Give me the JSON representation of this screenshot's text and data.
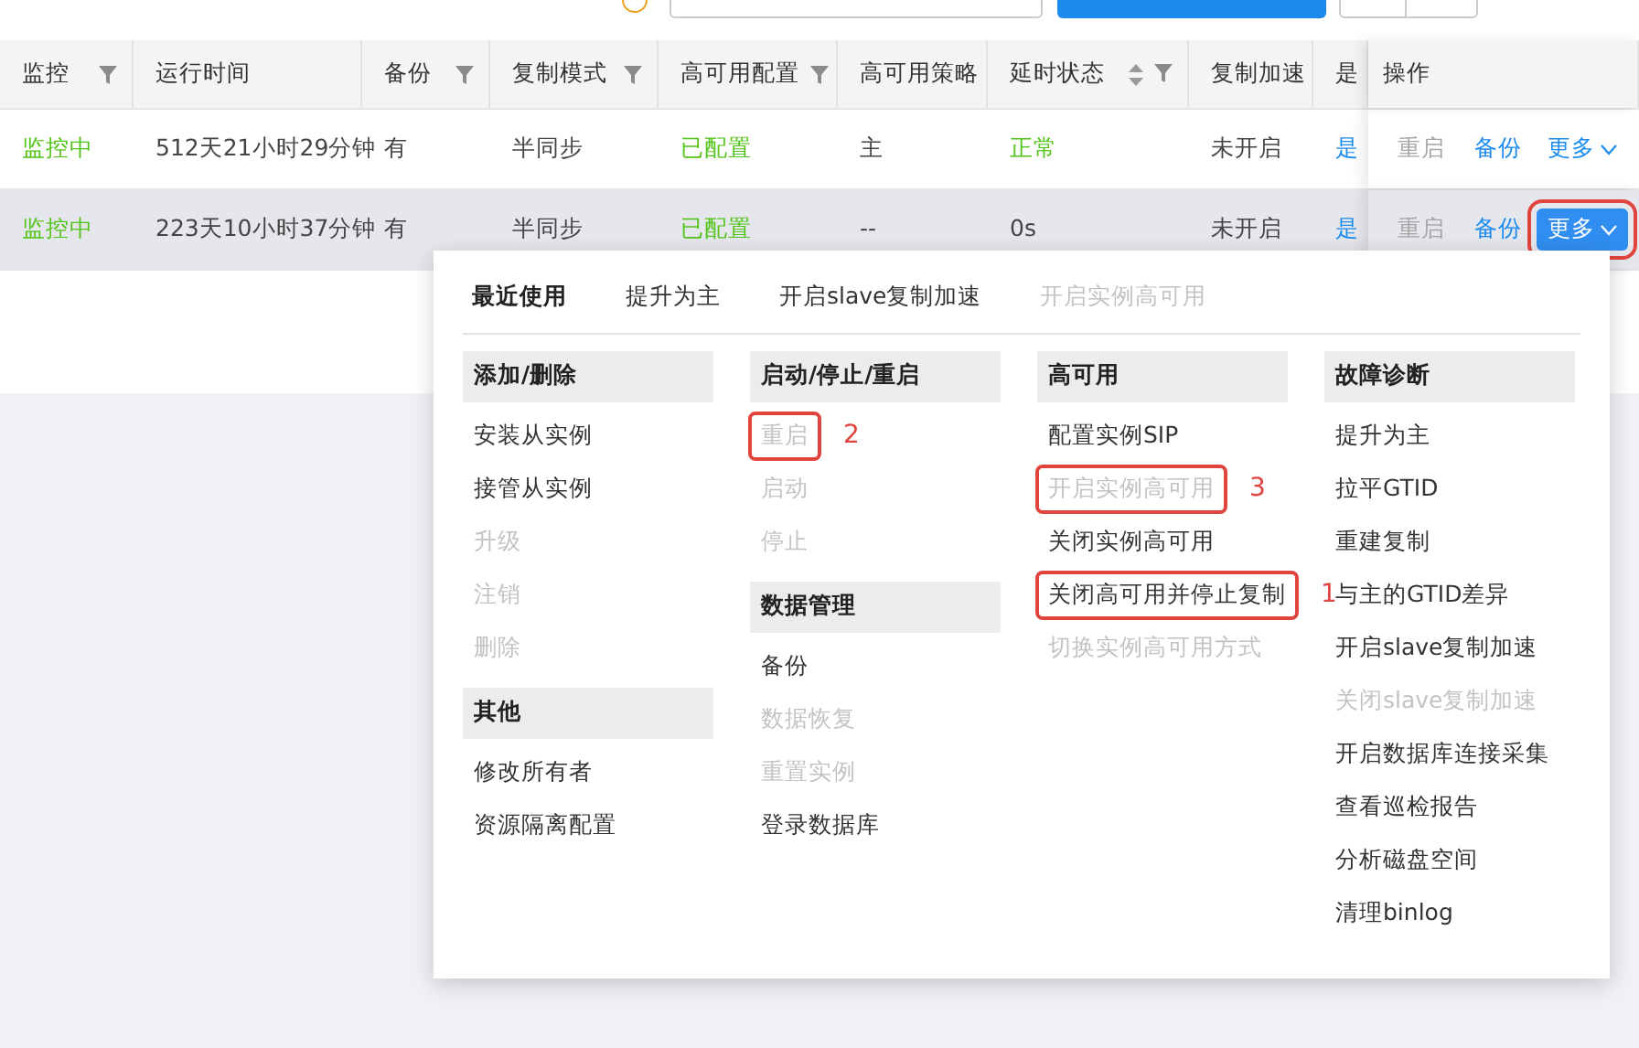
{
  "table": {
    "columns": [
      {
        "label": "监控",
        "filter": true,
        "sort": false
      },
      {
        "label": "运行时间",
        "filter": false,
        "sort": false
      },
      {
        "label": "备份",
        "filter": true,
        "sort": false
      },
      {
        "label": "复制模式",
        "filter": true,
        "sort": false
      },
      {
        "label": "高可用配置",
        "filter": true,
        "sort": false
      },
      {
        "label": "高可用策略",
        "filter": false,
        "sort": false
      },
      {
        "label": "延时状态",
        "filter": true,
        "sort": true
      },
      {
        "label": "复制加速",
        "filter": false,
        "sort": false
      },
      {
        "label": "是",
        "filter": false,
        "sort": false
      },
      {
        "label": "操作",
        "filter": false,
        "sort": false
      }
    ],
    "rows": [
      {
        "selected": false,
        "cells": [
          {
            "text": "监控中",
            "color": "#52c41a"
          },
          {
            "text": "512天21小时29分钟",
            "color": "#444444"
          },
          {
            "text": "有",
            "color": "#444444"
          },
          {
            "text": "半同步",
            "color": "#444444"
          },
          {
            "text": "已配置",
            "color": "#52c41a"
          },
          {
            "text": "主",
            "color": "#444444"
          },
          {
            "text": "正常",
            "color": "#52c41a"
          },
          {
            "text": "未开启",
            "color": "#444444"
          },
          {
            "text": "是",
            "color": "#1c8bf0"
          }
        ],
        "actions": [
          {
            "label": "重启",
            "disabled": true
          },
          {
            "label": "备份",
            "disabled": false
          }
        ],
        "more": {
          "label": "更多",
          "selected": false
        }
      },
      {
        "selected": true,
        "cells": [
          {
            "text": "监控中",
            "color": "#52c41a"
          },
          {
            "text": "223天10小时37分钟",
            "color": "#444444"
          },
          {
            "text": "有",
            "color": "#444444"
          },
          {
            "text": "半同步",
            "color": "#444444"
          },
          {
            "text": "已配置",
            "color": "#52c41a"
          },
          {
            "text": "--",
            "color": "#444444"
          },
          {
            "text": "0s",
            "color": "#444444"
          },
          {
            "text": "未开启",
            "color": "#444444"
          },
          {
            "text": "是",
            "color": "#1c8bf0"
          }
        ],
        "actions": [
          {
            "label": "重启",
            "disabled": true
          },
          {
            "label": "备份",
            "disabled": false
          }
        ],
        "more": {
          "label": "更多",
          "selected": true,
          "highlighted": true
        }
      }
    ]
  },
  "menu": {
    "recent": {
      "title": "最近使用",
      "items": [
        {
          "label": "提升为主",
          "disabled": false
        },
        {
          "label": "开启slave复制加速",
          "disabled": false
        },
        {
          "label": "开启实例高可用",
          "disabled": true
        }
      ]
    },
    "columns": [
      [
        {
          "title": "添加/删除",
          "items": [
            {
              "label": "安装从实例",
              "disabled": false
            },
            {
              "label": "接管从实例",
              "disabled": false
            },
            {
              "label": "升级",
              "disabled": true
            },
            {
              "label": "注销",
              "disabled": true
            },
            {
              "label": "删除",
              "disabled": true
            }
          ]
        },
        {
          "title": "其他",
          "items": [
            {
              "label": "修改所有者",
              "disabled": false
            },
            {
              "label": "资源隔离配置",
              "disabled": false
            }
          ]
        }
      ],
      [
        {
          "title": "启动/停止/重启",
          "items": [
            {
              "label": "重启",
              "disabled": true,
              "highlighted": true,
              "note": "2"
            },
            {
              "label": "启动",
              "disabled": true
            },
            {
              "label": "停止",
              "disabled": true
            }
          ]
        },
        {
          "title": "数据管理",
          "items": [
            {
              "label": "备份",
              "disabled": false
            },
            {
              "label": "数据恢复",
              "disabled": true
            },
            {
              "label": "重置实例",
              "disabled": true
            },
            {
              "label": "登录数据库",
              "disabled": false
            }
          ]
        }
      ],
      [
        {
          "title": "高可用",
          "items": [
            {
              "label": "配置实例SIP",
              "disabled": false
            },
            {
              "label": "开启实例高可用",
              "disabled": true,
              "highlighted": true,
              "note": "3"
            },
            {
              "label": "关闭实例高可用",
              "disabled": false
            },
            {
              "label": "关闭高可用并停止复制",
              "disabled": false,
              "highlighted": true,
              "note": "1"
            },
            {
              "label": "切换实例高可用方式",
              "disabled": true
            }
          ]
        }
      ],
      [
        {
          "title": "故障诊断",
          "items": [
            {
              "label": "提升为主",
              "disabled": false
            },
            {
              "label": "拉平GTID",
              "disabled": false
            },
            {
              "label": "重建复制",
              "disabled": false
            },
            {
              "label": "与主的GTID差异",
              "disabled": false
            },
            {
              "label": "开启slave复制加速",
              "disabled": false
            },
            {
              "label": "关闭slave复制加速",
              "disabled": true
            },
            {
              "label": "开启数据库连接采集",
              "disabled": false
            },
            {
              "label": "查看巡检报告",
              "disabled": false
            },
            {
              "label": "分析磁盘空间",
              "disabled": false
            },
            {
              "label": "清理binlog",
              "disabled": false
            }
          ]
        }
      ]
    ]
  }
}
